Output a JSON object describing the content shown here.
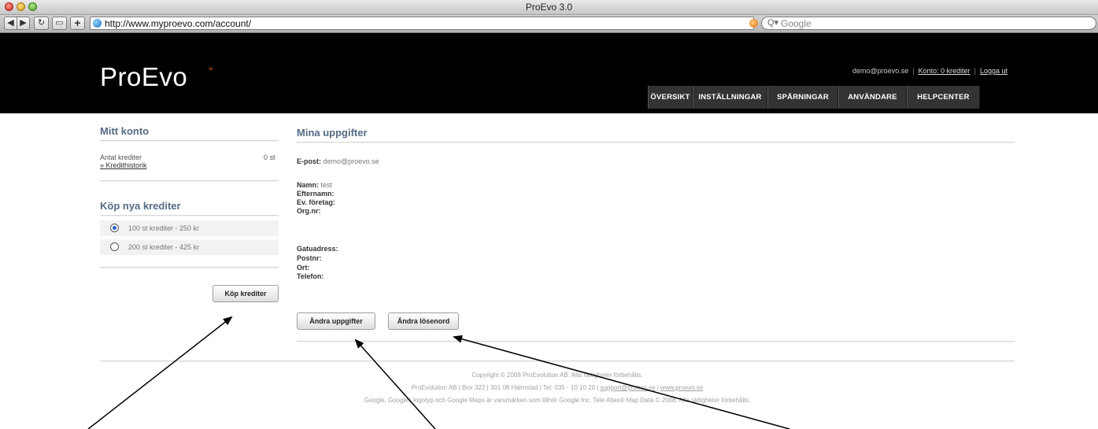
{
  "window": {
    "title": "ProEvo 3.0"
  },
  "browser": {
    "url": "http://www.myproevo.com/account/",
    "search_placeholder": "Google"
  },
  "site": {
    "logo": "ProEvo",
    "logo_mark": "°",
    "user_email": "demo@proevo.se",
    "account_link": "Konto: 0 krediter",
    "logout_link": "Logga ut",
    "nav": [
      "ÖVERSIKT",
      "INSTÄLLNINGAR",
      "SPÅRNINGAR",
      "ANVÄNDARE",
      "HELPCENTER"
    ]
  },
  "sidebar": {
    "my_account_title": "Mitt konto",
    "credits_label": "Antal krediter",
    "credits_value": "0 st",
    "history_link": "» Kredithistorik",
    "buy_title": "Köp nya krediter",
    "options": [
      {
        "label": "100 st krediter - 250 kr",
        "checked": true
      },
      {
        "label": "200 st krediter - 425 kr",
        "checked": false
      }
    ],
    "buy_button": "Köp krediter"
  },
  "main": {
    "title": "Mina uppgifter",
    "email_label": "E-post:",
    "email_value": "demo@proevo.se",
    "name_label": "Namn:",
    "name_value": "test",
    "lastname_label": "Efternamn:",
    "company_label": "Ev. företag:",
    "orgnr_label": "Org.nr:",
    "street_label": "Gatuadress:",
    "zip_label": "Postnr:",
    "city_label": "Ort:",
    "phone_label": "Telefon:",
    "edit_button": "Ändra uppgifter",
    "password_button": "Ändra lösenord"
  },
  "footer": {
    "line1": "Copyright © 2008 ProEvolution AB. Alla rättigheter förbehålls.",
    "line2_text": "ProEvolution AB | Box 322 | 301 08 Halmstad | Tel: 035 - 10 10 20 |",
    "line2_email": "support@proevo.se",
    "line2_site": "www.proevo.se",
    "line3": "Google, Googles logotyp och Google Maps är varumärken som tillhör Google Inc. Tele Atlas® Map Data © 2008. Alla rättigheter förbehålls."
  }
}
